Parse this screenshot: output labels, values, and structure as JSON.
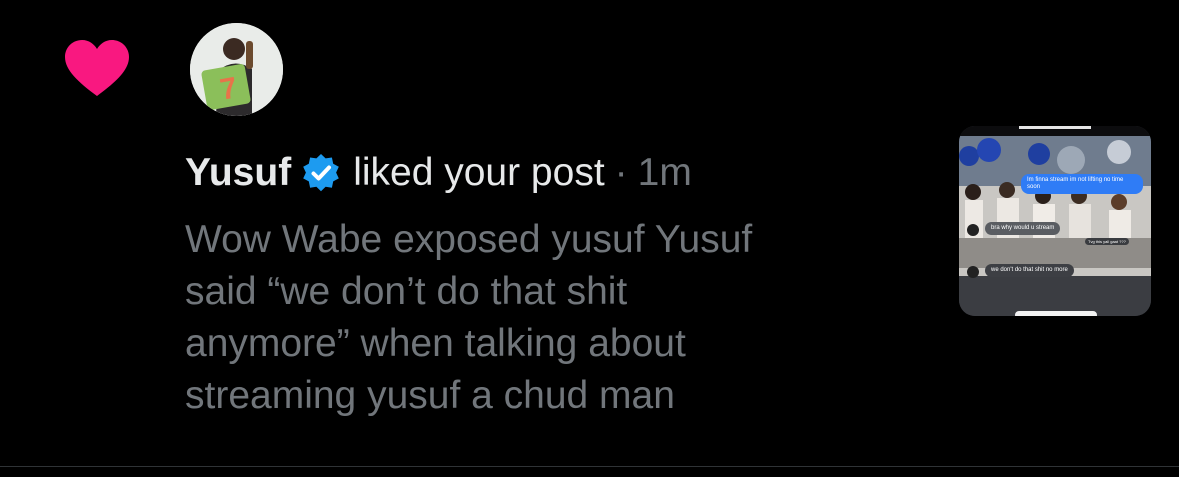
{
  "notification": {
    "user_name": "Yusuf",
    "action": "liked your post",
    "separator": "·",
    "time": "1m",
    "post_lines": [
      "Wow Wabe exposed yusuf  Yusuf",
      "said “we don’t do that shit",
      "anymore” when talking about",
      "streaming yusuf a chud man"
    ],
    "icons": {
      "like": "heart-icon",
      "verified": "verified-badge-icon",
      "avatar": "avatar"
    },
    "avatar_number": "7",
    "thumbnail": {
      "bubble_1": "Im finna stream im not lifting no time soon",
      "bubble_2": "bra why would u stream",
      "bubble_3": "Tvg this yall gaat ???",
      "bubble_4": "we don't do that shit no more"
    }
  },
  "colors": {
    "background": "#000000",
    "primary_text": "#e7e9ea",
    "secondary_text": "#71767b",
    "like_heart": "#f91880",
    "verified_badge": "#1d9bf0",
    "divider": "#2f3336"
  }
}
